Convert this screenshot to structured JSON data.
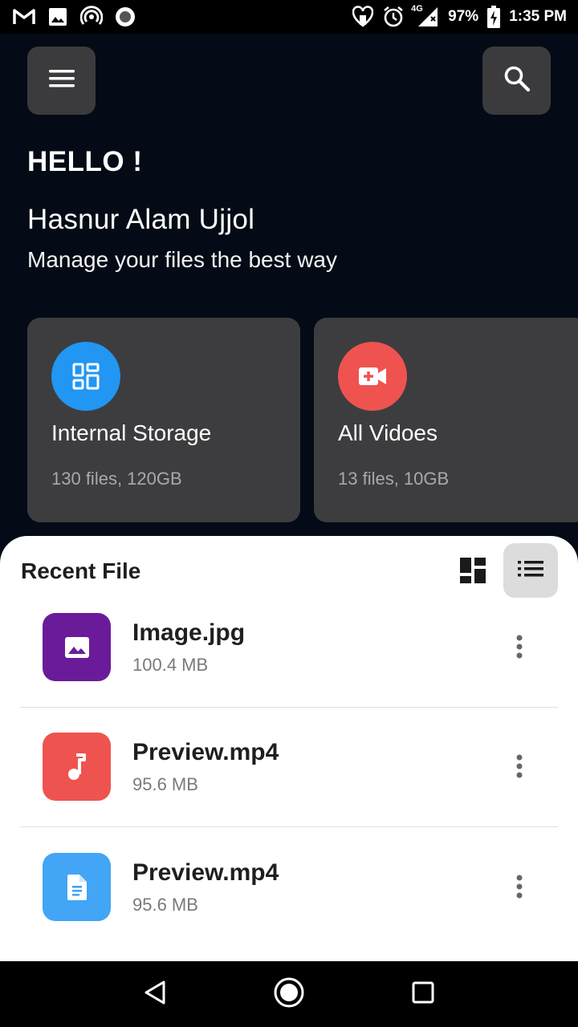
{
  "status_bar": {
    "left_icons": [
      "gmail-icon",
      "image-icon",
      "hotspot-icon",
      "record-icon"
    ],
    "network": "4G",
    "battery": "97%",
    "time": "1:35 PM"
  },
  "header": {
    "greeting": "HELLO !",
    "user_name": "Hasnur Alam Ujjol",
    "tagline": "Manage your files the best way"
  },
  "cards": [
    {
      "title": "Internal Storage",
      "subtitle": "130 files, 120GB",
      "icon": "storage-icon",
      "color": "#2196f3"
    },
    {
      "title": "All Vidoes",
      "subtitle": "13 files, 10GB",
      "icon": "video-add-icon",
      "color": "#ef5350"
    }
  ],
  "recent": {
    "title": "Recent File",
    "files": [
      {
        "name": "Image.jpg",
        "size": "100.4 MB",
        "icon": "image-icon",
        "color": "#6a1b9a"
      },
      {
        "name": "Preview.mp4",
        "size": "95.6 MB",
        "icon": "music-note-icon",
        "color": "#ef5350"
      },
      {
        "name": "Preview.mp4",
        "size": "95.6 MB",
        "icon": "document-icon",
        "color": "#42a5f5"
      }
    ]
  },
  "colors": {
    "background": "#040b16",
    "card": "#3d3d3f",
    "sheet": "#ffffff"
  }
}
